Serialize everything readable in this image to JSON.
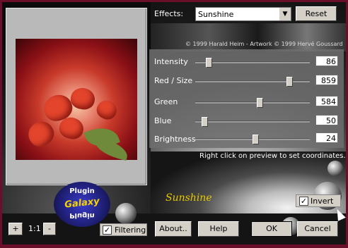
{
  "effects": {
    "label": "Effects:",
    "selected": "Sunshine",
    "reset_label": "Reset"
  },
  "copyright": "© 1999 Harald Heim - Artwork © 1999 Hervé Goussard",
  "sliders": [
    {
      "label": "Intensity",
      "value": "86",
      "fraction": 0.1
    },
    {
      "label": "Red / Size",
      "value": "859",
      "fraction": 0.84
    },
    {
      "label": "Green",
      "value": "584",
      "fraction": 0.57
    },
    {
      "label": "Blue",
      "value": "50",
      "fraction": 0.06
    },
    {
      "label": "Brightness",
      "value": "24",
      "fraction": 0.53
    }
  ],
  "hint": "Right click on preview to set coordinates.",
  "filter_name": "Sunshine",
  "brand": {
    "top": "Plugin",
    "middle": "Galaxy",
    "bottom": "Plugin"
  },
  "invert": {
    "label": "Invert",
    "checked": true
  },
  "filtering": {
    "label": "Filtering",
    "checked": true
  },
  "zoom": {
    "plus": "+",
    "level": "1:1",
    "minus": "-"
  },
  "buttons": {
    "about": "About..",
    "help": "Help",
    "ok": "OK",
    "cancel": "Cancel"
  }
}
